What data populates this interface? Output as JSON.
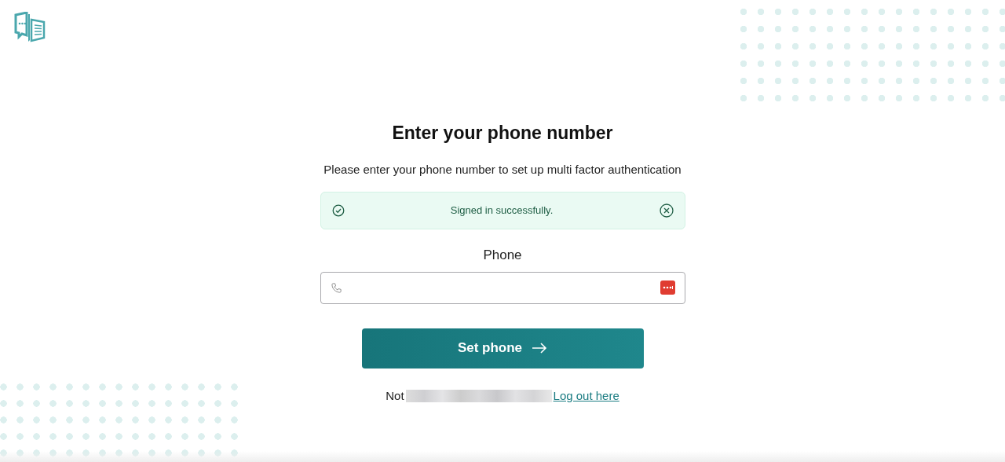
{
  "title": "Enter your phone number",
  "subtitle": "Please enter your phone number to set up multi factor authentication",
  "alert": {
    "message": "Signed in successfully."
  },
  "phone": {
    "label": "Phone"
  },
  "submit": {
    "label": "Set phone"
  },
  "footer": {
    "prefix": "Not",
    "link": "Log out here"
  }
}
